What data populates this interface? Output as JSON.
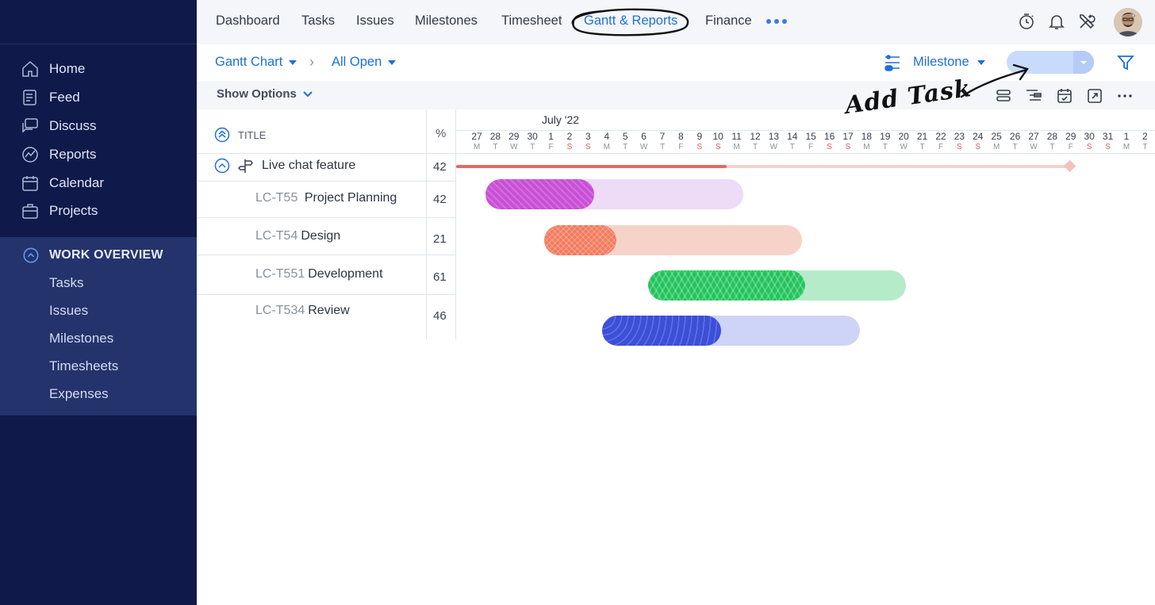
{
  "sidebar": {
    "items": [
      {
        "label": "Home",
        "icon": "home-icon"
      },
      {
        "label": "Feed",
        "icon": "feed-icon"
      },
      {
        "label": "Discuss",
        "icon": "discuss-icon"
      },
      {
        "label": "Reports",
        "icon": "reports-icon"
      },
      {
        "label": "Calendar",
        "icon": "calendar-icon"
      },
      {
        "label": "Projects",
        "icon": "projects-icon"
      }
    ],
    "work_overview": {
      "title": "WORK OVERVIEW",
      "items": [
        "Tasks",
        "Issues",
        "Milestones",
        "Timesheets",
        "Expenses"
      ]
    }
  },
  "topnav": {
    "tabs": [
      "Dashboard",
      "Tasks",
      "Issues",
      "Milestones",
      "Timesheet",
      "Gantt & Reports",
      "Finance"
    ],
    "active_tab": "Gantt & Reports",
    "icons": [
      "timer-icon",
      "bell-icon",
      "tools-icon"
    ]
  },
  "toolbar": {
    "view": "Gantt Chart",
    "filter_view": "All Open",
    "group_by": "Milestone",
    "icons": [
      "milestone-toggle-icon",
      "filter-icon"
    ]
  },
  "options": {
    "show_options": "Show Options",
    "icons": [
      "collapse-rows-icon",
      "indent-icon",
      "calendar-today-icon",
      "expand-icon",
      "more-icon"
    ]
  },
  "annotation": {
    "text": "Add Task"
  },
  "table": {
    "header_title": "TITLE",
    "header_pct": "%",
    "parent": {
      "title": "Live chat feature",
      "pct": "42",
      "progress": 0.42
    },
    "tasks": [
      {
        "id": "LC-T55",
        "name": "Project Planning",
        "pct": "42",
        "progress": 0.42,
        "color": "#c94fd6",
        "light": "#eedbf5"
      },
      {
        "id": "LC-T54",
        "name": "Design",
        "pct": "21",
        "progress": 0.28,
        "color": "#f27a5c",
        "light": "#f6d3c8"
      },
      {
        "id": "LC-T551",
        "name": "Development",
        "pct": "61",
        "progress": 0.61,
        "color": "#21c45a",
        "light": "#b5ebc9"
      },
      {
        "id": "LC-T534",
        "name": "Review",
        "pct": "46",
        "progress": 0.46,
        "color": "#3c4fd8",
        "light": "#cdd4f7"
      }
    ]
  },
  "timeline": {
    "month": "July '22",
    "days": [
      "27",
      "28",
      "29",
      "30",
      "1",
      "2",
      "3",
      "4",
      "5",
      "6",
      "7",
      "8",
      "9",
      "10",
      "11",
      "12",
      "13",
      "14",
      "15",
      "16",
      "17",
      "18",
      "19",
      "20",
      "21",
      "22",
      "23",
      "24",
      "25",
      "26",
      "27",
      "28",
      "29",
      "30",
      "31",
      "1",
      "2"
    ],
    "weekdays": [
      "M",
      "T",
      "W",
      "T",
      "F",
      "S",
      "S",
      "M",
      "T",
      "W",
      "T",
      "F",
      "S",
      "S",
      "M",
      "T",
      "W",
      "T",
      "F",
      "S",
      "S",
      "M",
      "T",
      "W",
      "T",
      "F",
      "S",
      "S",
      "M",
      "T",
      "W",
      "T",
      "F",
      "S",
      "S",
      "M",
      "T"
    ]
  },
  "colors": {
    "sidebar_bg": "#0f1a4a",
    "accent": "#1f6fd8",
    "parent_bar": "#e06b63"
  }
}
